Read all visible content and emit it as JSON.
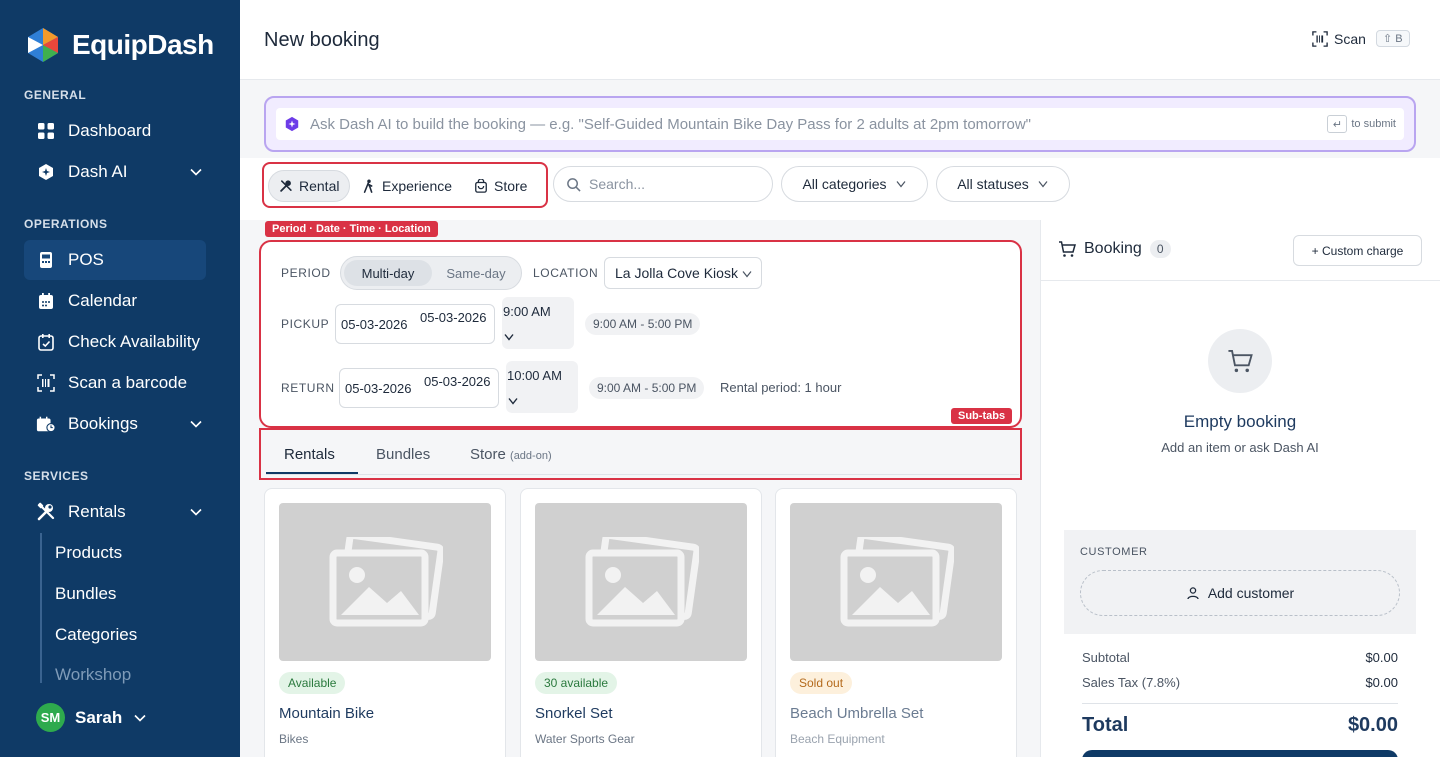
{
  "app": {
    "name": "EquipDash"
  },
  "sidebar": {
    "sections": {
      "general": "GENERAL",
      "operations": "OPERATIONS",
      "services": "SERVICES"
    },
    "items": {
      "dashboard": "Dashboard",
      "dash_ai": "Dash AI",
      "pos": "POS",
      "calendar": "Calendar",
      "check_availability": "Check Availability",
      "scan_barcode": "Scan a barcode",
      "bookings": "Bookings",
      "rentals": "Rentals"
    },
    "rentals_sub": [
      "Products",
      "Bundles",
      "Categories",
      "Workshop"
    ],
    "user": {
      "initials": "SM",
      "name": "Sarah"
    }
  },
  "header": {
    "title": "New booking",
    "scan_label": "Scan",
    "scan_shortcut": "⇧ B"
  },
  "ai": {
    "placeholder": "Ask Dash AI to build the booking — e.g. \"Self-Guided Mountain Bike Day Pass for 2 adults at 2pm tomorrow\"",
    "submit_hint": "to submit",
    "enter_glyph": "↵"
  },
  "modes": [
    "Rental",
    "Experience",
    "Store"
  ],
  "filters": {
    "search_placeholder": "Search...",
    "categories": "All categories",
    "statuses": "All statuses"
  },
  "annotations": {
    "period_tag": "Period · Date · Time · Location",
    "subtabs_tag": "Sub-tabs"
  },
  "period": {
    "period_label": "PERIOD",
    "options": [
      "Multi-day",
      "Same-day"
    ],
    "location_label": "LOCATION",
    "location_value": "La Jolla Cove Kiosk",
    "pickup_label": "PICKUP",
    "pickup_date_display": "05-03-2026",
    "pickup_date_value": "05-03-2026",
    "pickup_time": "9:00 AM",
    "pickup_hours": "9:00 AM - 5:00 PM",
    "return_label": "RETURN",
    "return_date_display": "05-03-2026",
    "return_date_value": "05-03-2026",
    "return_time": "10:00 AM",
    "return_hours": "9:00 AM - 5:00 PM",
    "rental_period": "Rental period: 1 hour"
  },
  "subtabs": {
    "rentals": "Rentals",
    "bundles": "Bundles",
    "store": "Store",
    "store_addon": "(add-on)"
  },
  "products": [
    {
      "status": "Available",
      "name": "Mountain Bike",
      "category": "Bikes"
    },
    {
      "status": "30 available",
      "name": "Snorkel Set",
      "category": "Water Sports Gear"
    },
    {
      "status": "Sold out",
      "name": "Beach Umbrella Set",
      "category": "Beach Equipment"
    }
  ],
  "booking": {
    "title": "Booking",
    "count": "0",
    "custom_charge": "+ Custom charge",
    "empty_title": "Empty booking",
    "empty_sub": "Add an item or ask Dash AI",
    "customer_label": "CUSTOMER",
    "add_customer": "Add customer",
    "subtotal_label": "Subtotal",
    "subtotal_value": "$0.00",
    "tax_label": "Sales Tax (7.8%)",
    "tax_value": "$0.00",
    "total_label": "Total",
    "total_value": "$0.00"
  },
  "colors": {
    "sidebar": "#0f3a66",
    "annotation": "#d93245",
    "ai_border": "#b9a5f0"
  }
}
